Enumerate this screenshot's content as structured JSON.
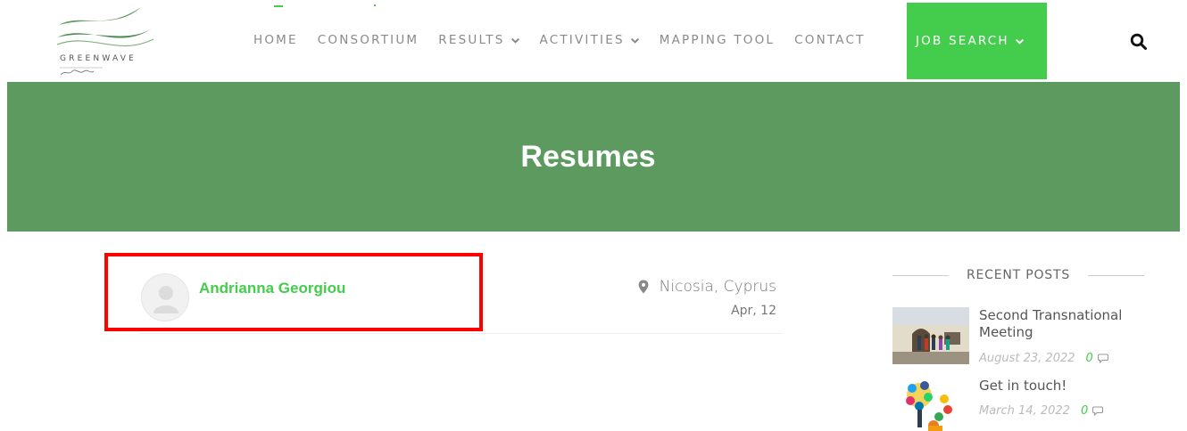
{
  "header": {
    "logo_text": "GREENWAVE",
    "nav": [
      {
        "label": "HOME",
        "has_dropdown": false
      },
      {
        "label": "CONSORTIUM",
        "has_dropdown": false
      },
      {
        "label": "RESULTS",
        "has_dropdown": true
      },
      {
        "label": "ACTIVITIES",
        "has_dropdown": true
      },
      {
        "label": "MAPPING TOOL",
        "has_dropdown": false
      },
      {
        "label": "CONTACT",
        "has_dropdown": false
      }
    ],
    "job_search_label": "JOB SEARCH",
    "search_icon": "search-icon"
  },
  "banner": {
    "title": "Resumes"
  },
  "resume": {
    "name": "Andrianna Georgiou",
    "location": "Nicosia, Cyprus",
    "date": "Apr, 12"
  },
  "sidebar": {
    "heading": "RECENT POSTS",
    "posts": [
      {
        "title": "Second Transnational Meeting",
        "date": "August 23, 2022",
        "comments": "0"
      },
      {
        "title": "Get in touch!",
        "date": "March 14, 2022",
        "comments": "0"
      }
    ]
  },
  "colors": {
    "accent_green": "#44cc4c",
    "banner_green": "#5d9a5f",
    "highlight_red": "#ff0000"
  }
}
